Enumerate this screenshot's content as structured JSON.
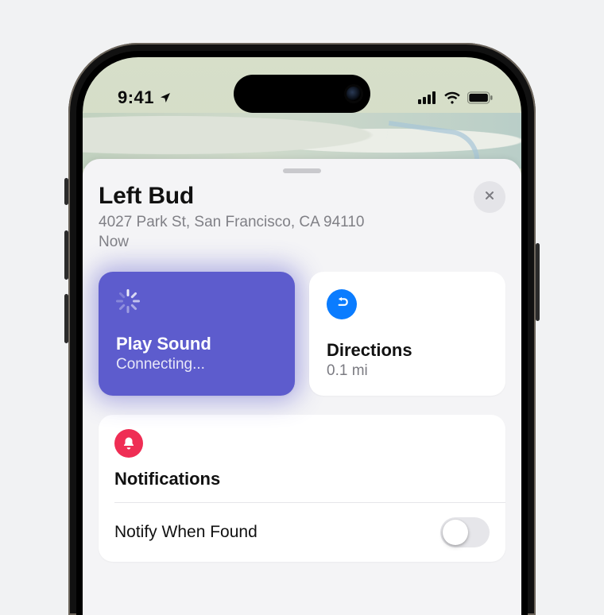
{
  "status": {
    "time": "9:41",
    "location_services": true
  },
  "sheet": {
    "title": "Left Bud",
    "address": "4027 Park St, San Francisco, CA  94110",
    "time_ago": "Now"
  },
  "actions": {
    "play_sound": {
      "label": "Play Sound",
      "status": "Connecting...",
      "active": true
    },
    "directions": {
      "label": "Directions",
      "distance": "0.1 mi"
    }
  },
  "notifications": {
    "section_title": "Notifications",
    "notify_when_found": {
      "label": "Notify When Found",
      "enabled": false
    }
  },
  "colors": {
    "accent_purple": "#5d5ccd",
    "accent_blue": "#0a7cff",
    "accent_red": "#ef2d54"
  }
}
